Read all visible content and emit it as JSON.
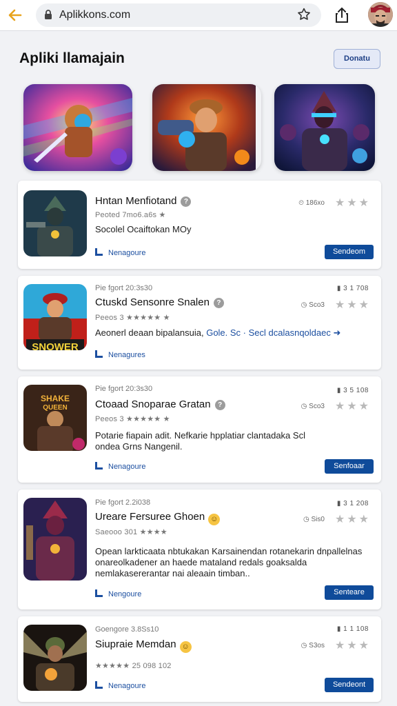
{
  "browser": {
    "url": "Aplikkons.com",
    "back_icon": "back-arrow-icon",
    "lock_icon": "lock-icon",
    "bookmark_icon": "star-icon",
    "share_icon": "share-icon"
  },
  "page": {
    "title": "Apliki llamajain",
    "top_button": "Donatu",
    "accent_color": "#0f4b9a",
    "back_color": "#e8a31c"
  },
  "apps": [
    {
      "meta": "",
      "title": "Hntan Menfiotand",
      "subtitle": "Peoted 7mo6.a6s  ★",
      "description": "Socolel Ocaiftokan MOy",
      "description_link": "",
      "stats": "",
      "rating_count": "186xo",
      "tag": "Nenagoure",
      "action": "Sendeom"
    },
    {
      "meta": "Pie fgort 20:3s30",
      "title": "Ctuskd Sensonre Snalen",
      "subtitle": "Peeos 3 ★★★★★ ★",
      "description": "Aeonerl deaan bipalansuia,",
      "description_link": "Gole. Sc · Secl dcalasnqoldaec ➜",
      "stats": "3   1   708",
      "rating_count": "Sco3",
      "tag": "Nenagures",
      "action": ""
    },
    {
      "meta": "Pie fgort 20:3s30",
      "title": "Ctoaad Snoparae Gratan",
      "subtitle": "Peeos 3 ★★★★★ ★",
      "description": "Potarie fiapain adit. Nefkarie hpplatiar clantadaka Scl ondea Grns Nangenil.",
      "description_link": "",
      "stats": "3   5   108",
      "rating_count": "Sco3",
      "tag": "Nenagoure",
      "action": "Senfoaar"
    },
    {
      "meta": "Pie fgort 2.2i038",
      "title": "Ureare Fersuree Ghoen",
      "subtitle": "Saeooo 301 ★★★★",
      "description": "Opean larkticaata nbtukakan Karsainendan rotanekarin dnpallelnas onareolkadener an haede mataland redals goaksalda nemlakasererantar nai aleaain timban..",
      "description_link": "",
      "stats": "3   1   208",
      "rating_count": "Sis0",
      "tag": "Nengoure",
      "action": "Senteare"
    },
    {
      "meta": "Goengore 3.8Ss10",
      "title": "Siupraie Memdan",
      "subtitle": "★★★★★  25  098  102",
      "description": "",
      "description_link": "",
      "stats": "1   1   108",
      "rating_count": "S3os",
      "tag": "Nenagoure",
      "action": "Sendeont"
    }
  ]
}
